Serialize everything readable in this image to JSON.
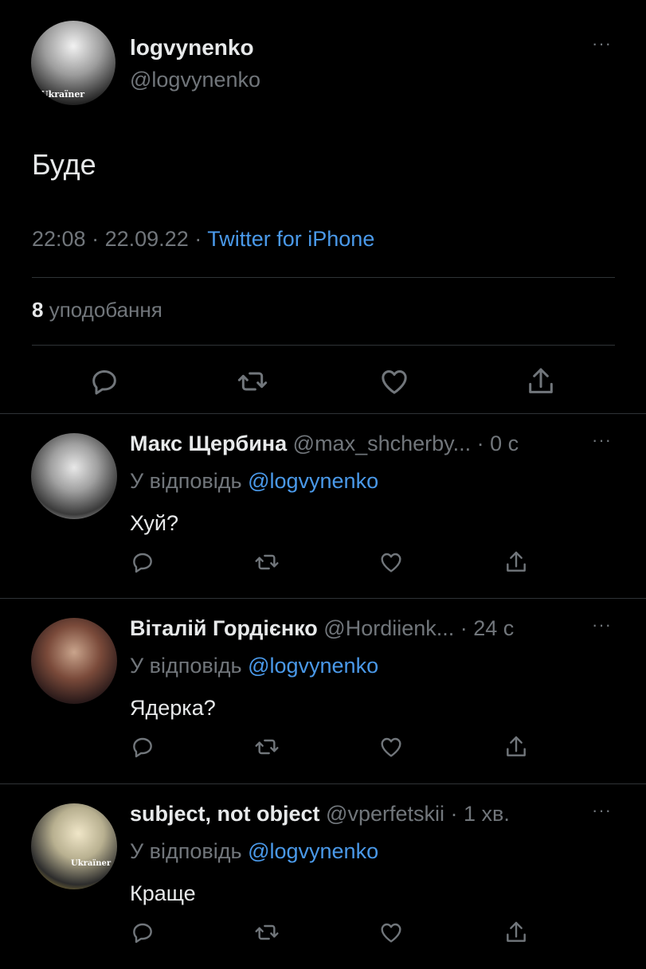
{
  "main_tweet": {
    "display_name": "logvynenko",
    "handle": "@logvynenko",
    "avatar_shirt_text": "Ukraïner",
    "text": "Буде",
    "time": "22:08",
    "date": "22.09.22",
    "source": "Twitter for iPhone",
    "separator": "·",
    "likes_count": "8",
    "likes_label": "уподобання",
    "more": "···"
  },
  "replies": [
    {
      "display_name": "Макс Щербина",
      "handle": "@max_shcherby...",
      "time_ago": "· 0 с",
      "reply_prefix": "У відповідь",
      "reply_to": "@logvynenko",
      "text": "Хуй?",
      "more": "···"
    },
    {
      "display_name": "Віталій Гордієнко",
      "handle": "@Hordiienk...",
      "time_ago": "· 24 с",
      "reply_prefix": "У відповідь",
      "reply_to": "@logvynenko",
      "text": "Ядерка?",
      "more": "···"
    },
    {
      "display_name": "subject, not object",
      "handle": "@vperfetskii",
      "time_ago": "· 1 хв.",
      "reply_prefix": "У відповідь",
      "reply_to": "@logvynenko",
      "text": "Краще",
      "more": "···",
      "avatar_shirt_text": "Ukraïner"
    }
  ],
  "colors": {
    "background": "#000000",
    "text_primary": "#e7e9ea",
    "text_secondary": "#71767b",
    "link": "#4a99e9",
    "divider": "#2f3336"
  },
  "icons": [
    "reply-icon",
    "retweet-icon",
    "like-icon",
    "share-icon",
    "more-icon"
  ]
}
